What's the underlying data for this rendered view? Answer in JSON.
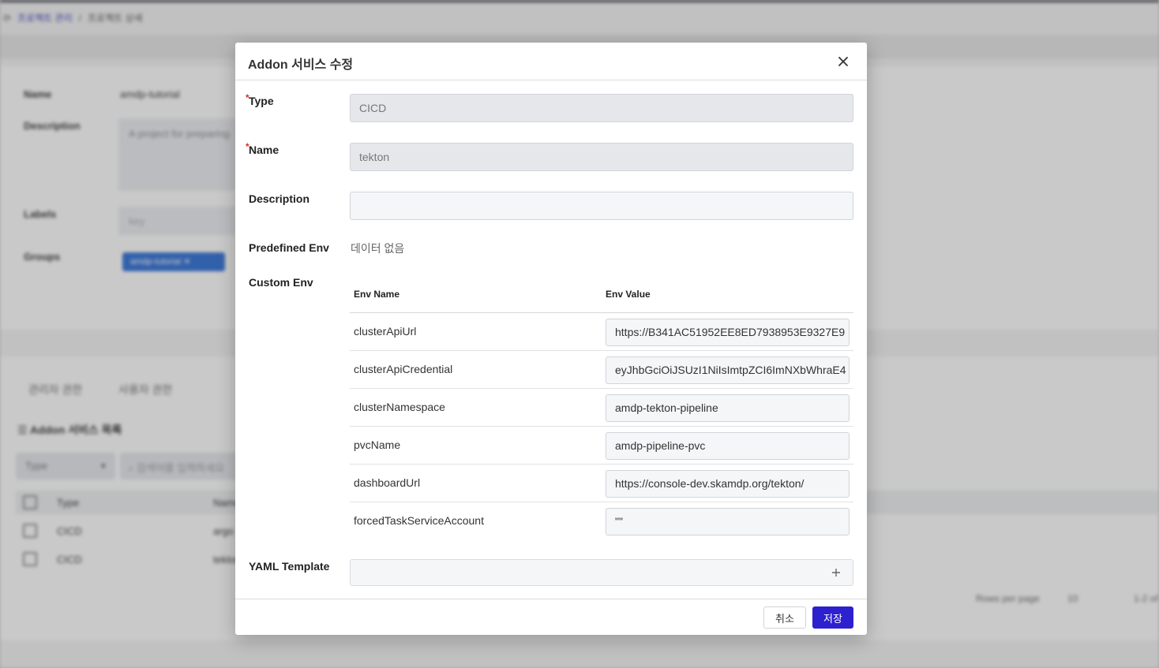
{
  "background": {
    "breadcrumb": [
      "프로젝트 관리",
      "프로젝트 상세"
    ],
    "fields": [
      {
        "label": "Name",
        "value": "amdp-tutorial"
      },
      {
        "label": "Description",
        "value": "A project for preparing"
      },
      {
        "label": "Labels",
        "value": "key"
      },
      {
        "label": "Groups",
        "value": "amdp-tutorial"
      }
    ],
    "tabs": [
      "관리자 권한",
      "사용자 권한"
    ],
    "list_title": "Addon 서비스 목록",
    "type_select": "Type",
    "search_placeholder": "검색어를 입력하세요",
    "table_headers": [
      "Type",
      "Name"
    ],
    "table_rows": [
      [
        "CICD",
        "argo"
      ],
      [
        "CICD",
        "tekton"
      ]
    ],
    "pager": {
      "rows_per_page_label": "Rows per page",
      "rows_per_page": "10",
      "range": "1-2 of"
    }
  },
  "modal": {
    "title": "Addon 서비스 수정",
    "fields": {
      "type": {
        "label": "Type",
        "value": "CICD",
        "required": true
      },
      "name": {
        "label": "Name",
        "value": "tekton",
        "required": true
      },
      "description": {
        "label": "Description",
        "value": ""
      },
      "predefined_env": {
        "label": "Predefined Env",
        "value": "데이터 없음"
      },
      "custom_env": {
        "label": "Custom Env"
      },
      "yaml_template": {
        "label": "YAML Template"
      }
    },
    "env_table": {
      "headers": [
        "Env Name",
        "Env Value"
      ],
      "rows": [
        {
          "name": "clusterApiUrl",
          "value": "https://B341AC51952EE8ED7938953E9327E9"
        },
        {
          "name": "clusterApiCredential",
          "value": "eyJhbGciOiJSUzI1NiIsImtpZCI6ImNXbWhraE4"
        },
        {
          "name": "clusterNamespace",
          "value": "amdp-tekton-pipeline"
        },
        {
          "name": "pvcName",
          "value": "amdp-pipeline-pvc"
        },
        {
          "name": "dashboardUrl",
          "value": "https://console-dev.skamdp.org/tekton/"
        },
        {
          "name": "forcedTaskServiceAccount",
          "value": "\"\""
        }
      ]
    },
    "buttons": {
      "cancel": "취소",
      "save": "저장"
    },
    "colors": {
      "primary": "#2c20cf",
      "required": "#d9302c"
    }
  }
}
